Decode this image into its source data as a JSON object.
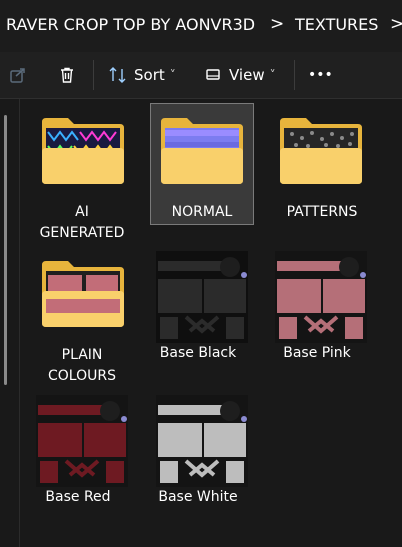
{
  "breadcrumb": {
    "items": [
      "RAVER CROP TOP BY AONVR3D",
      "TEXTURES"
    ],
    "separator": ">"
  },
  "toolbar": {
    "sort_label": "Sort",
    "view_label": "View",
    "more_label": "•••",
    "dropdown_caret": "˅"
  },
  "items": [
    {
      "label_lines": [
        "AI",
        "GENERATED"
      ],
      "kind": "folder",
      "preview": "multicolor-pattern"
    },
    {
      "label_lines": [
        "NORMAL"
      ],
      "kind": "folder",
      "preview": "normal-map",
      "selected": true
    },
    {
      "label_lines": [
        "PATTERNS"
      ],
      "kind": "folder",
      "preview": "grey-pattern"
    },
    {
      "label_lines": [
        "PLAIN",
        "COLOURS"
      ],
      "kind": "folder",
      "preview": "pink-plain"
    },
    {
      "label_lines": [
        "Base Black"
      ],
      "kind": "image",
      "tint": "#2b2b2b"
    },
    {
      "label_lines": [
        "Base Pink"
      ],
      "kind": "image",
      "tint": "#b56f78"
    },
    {
      "label_lines": [
        "Base Red"
      ],
      "kind": "image",
      "tint": "#6e1a22"
    },
    {
      "label_lines": [
        "Base White"
      ],
      "kind": "image",
      "tint": "#bdbdbd"
    }
  ],
  "colors": {
    "folder_back": "#e7b43c",
    "folder_front": "#f9d06b",
    "selection": "#3a3a3a"
  }
}
